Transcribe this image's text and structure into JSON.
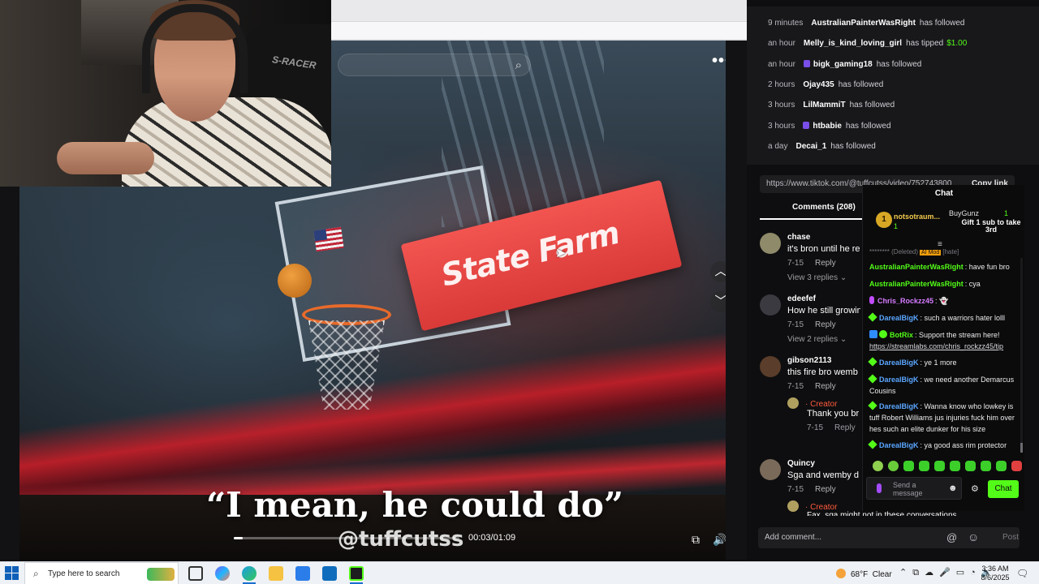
{
  "browser": {},
  "video": {
    "caption": "“I mean, he could do”",
    "watermark": "@tuffcutss",
    "time": "00:03/01:09",
    "progress": 0.04,
    "banner_brand": "State Farm",
    "more_icon": "more-dots-icon"
  },
  "webcam": {
    "chair_text": "S-RACER"
  },
  "events": [
    {
      "when": "9 minutes",
      "user": "AustralianPainterWasRight",
      "action": "has followed",
      "amount": ""
    },
    {
      "when": "an hour",
      "user": "Melly_is_kind_loving_girl",
      "action": "has tipped",
      "amount": "$1.00"
    },
    {
      "when": "an hour",
      "user": "bigk_gaming18",
      "action": "has followed",
      "amount": "",
      "badge": true
    },
    {
      "when": "2 hours",
      "user": "Ojay435",
      "action": "has followed",
      "amount": ""
    },
    {
      "when": "3 hours",
      "user": "LilMammiT",
      "action": "has followed",
      "amount": ""
    },
    {
      "when": "3 hours",
      "user": "htbabie",
      "action": "has followed",
      "amount": "",
      "badge": true
    },
    {
      "when": "a day",
      "user": "Decai_1",
      "action": "has followed",
      "amount": ""
    }
  ],
  "tiktok": {
    "url": "https://www.tiktok.com/@tuffcutss/video/752743800",
    "copy_link": "Copy link",
    "tab_comments": "Comments (208)",
    "add_comment_placeholder": "Add comment...",
    "post": "Post",
    "comments": [
      {
        "user": "chase",
        "text": "it's bron until he re",
        "date": "7-15",
        "reply": "Reply",
        "replies": "View 3 replies ⌄"
      },
      {
        "user": "edeefef",
        "text": "How he still growin",
        "date": "7-15",
        "reply": "Reply",
        "replies": "View 2 replies ⌄"
      },
      {
        "user": "gibson2113",
        "text": "this fire bro wemb",
        "date": "7-15",
        "reply": "Reply",
        "replies": ""
      },
      {
        "user": "Quincy",
        "text": "Sga and wemby d",
        "date": "7-15",
        "reply": "Reply",
        "replies": ""
      }
    ],
    "creator_label": "· Creator",
    "creator_reply_1": "Thank you br",
    "creator_reply_1_date": "7-15",
    "creator_reply_1_reply": "Reply",
    "creator_reply_2": "Fax, sga might not in these conversations"
  },
  "chat": {
    "title": "Chat",
    "pinned_left_user": "notsotraum...",
    "pinned_left_count": "1",
    "pinned_left_rank": "1",
    "pinned_right_user": "BuyGunz",
    "pinned_right_count": "1",
    "pinned_right_msg": "Gift 1 sub to take 3rd",
    "deleted_prefix": "******** (Deleted)",
    "deleted_mod": "AI Mod",
    "deleted_reason": "[hate]",
    "messages": [
      {
        "user": "AustralianPainterWasRight",
        "text": ": have fun bro",
        "color": "g"
      },
      {
        "user": "AustralianPainterWasRight",
        "text": ": cya",
        "color": "g"
      },
      {
        "user": "Chris_Rockzz45",
        "text": ": 👻",
        "color": "p"
      },
      {
        "user": "DarealBigK",
        "text": ": such a warriors hater lolll",
        "color": "b"
      },
      {
        "user": "BotRix",
        "text": ": Support the stream here!",
        "color": "g",
        "link": "https://streamlabs.com/chris_rockzz45/tip"
      },
      {
        "user": "DarealBigK",
        "text": ": ye 1 more",
        "color": "b"
      },
      {
        "user": "DarealBigK",
        "text": ": we need another Demarcus Cousins",
        "color": "b"
      },
      {
        "user": "DarealBigK",
        "text": ": Wanna know who lowkey is tuff Robert Williams jus injuries fuck him over hes such an elite dunker for his size",
        "color": "b"
      },
      {
        "user": "DarealBigK",
        "text": ": ya good ass rim protector",
        "color": "b"
      }
    ],
    "input_placeholder": "Send a message",
    "send_label": "Chat"
  },
  "taskbar": {
    "search_placeholder": "Type here to search",
    "weather_temp": "68°F",
    "weather_text": "Clear",
    "time": "3:36 AM",
    "date": "8/6/2025"
  }
}
